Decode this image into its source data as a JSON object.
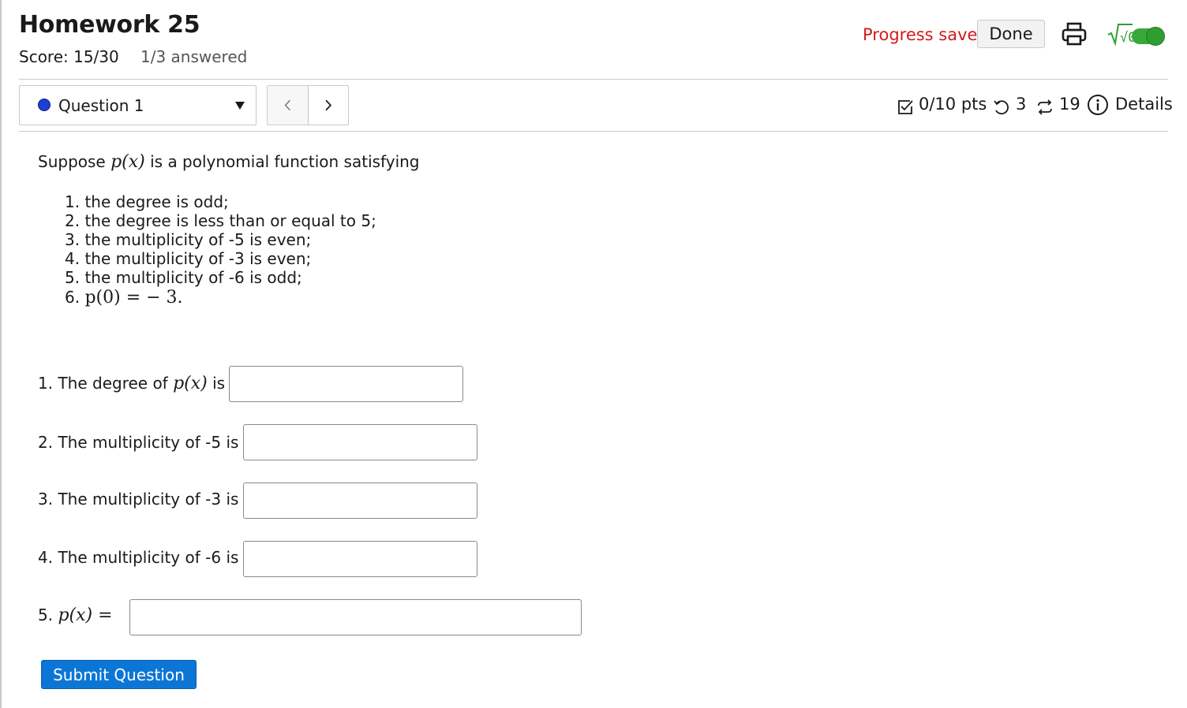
{
  "header": {
    "title": "Homework 25",
    "score": "Score: 15/30",
    "answered": "1/3 answered",
    "progress_status": "Progress saved",
    "done_label": "Done",
    "sqrt_label": "√0"
  },
  "question_nav": {
    "selected": "Question 1",
    "prev_icon": "chevron-left-icon",
    "next_icon": "chevron-right-icon"
  },
  "question_meta": {
    "points": "0/10 pts",
    "attempts": "3",
    "versions": "19",
    "details_label": "Details"
  },
  "problem": {
    "intro_prefix": "Suppose ",
    "intro_math": "p(x)",
    "intro_suffix": " is a polynomial function satisfying",
    "conditions": [
      "1. the degree is odd;",
      "2. the degree is less than or equal to 5;",
      "3. the multiplicity of -5 is even;",
      "4. the multiplicity of -3 is even;",
      "5. the multiplicity of -6 is odd;"
    ],
    "condition6_prefix": "6. ",
    "condition6_math": "p(0) = − 3."
  },
  "answers": {
    "q1_prefix": "1. The degree of ",
    "q1_math": "p(x)",
    "q1_suffix": " is",
    "q2": "2. The multiplicity of -5 is",
    "q3": "3. The multiplicity of -3 is",
    "q4": "4. The multiplicity of -6 is",
    "q5_prefix": "5. ",
    "q5_math": "p(x) =",
    "values": [
      "",
      "",
      "",
      "",
      ""
    ]
  },
  "submit_label": "Submit Question",
  "colors": {
    "accent_blue": "#0b76d6",
    "status_red": "#d11b1b",
    "toggle_green": "#39a83a",
    "question_dot": "#1e3ed6"
  }
}
